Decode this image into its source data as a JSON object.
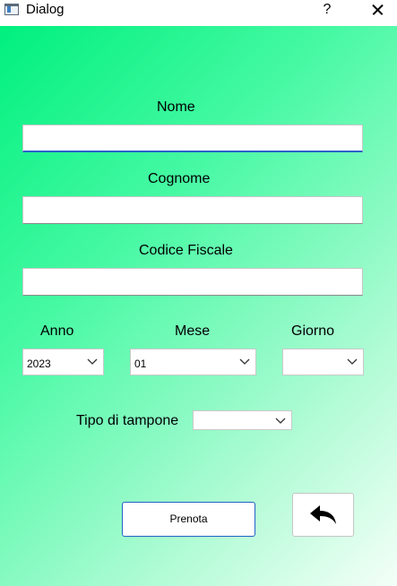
{
  "window": {
    "title": "Dialog",
    "help_label": "?",
    "close_icon": "close-icon",
    "app_icon": "window-app-icon"
  },
  "form": {
    "nome_label": "Nome",
    "nome_value": "",
    "cognome_label": "Cognome",
    "cognome_value": "",
    "codice_fiscale_label": "Codice Fiscale",
    "codice_fiscale_value": "",
    "anno_label": "Anno",
    "anno_value": "2023",
    "mese_label": "Mese",
    "mese_value": "01",
    "giorno_label": "Giorno",
    "giorno_value": "",
    "tampone_label": "Tipo di tampone",
    "tampone_value": ""
  },
  "buttons": {
    "prenota_label": "Prenota",
    "back_icon": "undo-arrow-icon"
  },
  "colors": {
    "gradient_start": "#00f07e",
    "gradient_end": "#f4fff8",
    "focus_accent": "#2a62c9"
  }
}
